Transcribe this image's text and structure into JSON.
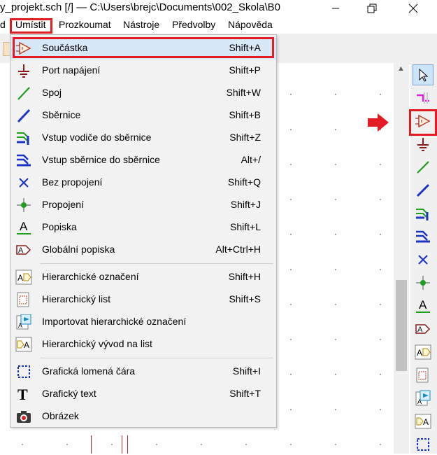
{
  "window": {
    "title": "y_projekt.sch [/] — C:\\Users\\brejc\\Documents\\002_Skola\\B0"
  },
  "menubar": {
    "items": [
      {
        "label": "d"
      },
      {
        "label": "Umístit"
      },
      {
        "label": "Prozkoumat"
      },
      {
        "label": "Nástroje"
      },
      {
        "label": "Předvolby"
      },
      {
        "label": "Nápověda"
      }
    ]
  },
  "dropdown": {
    "items": [
      {
        "label": "Součástka",
        "shortcut": "Shift+A",
        "icon": "component-icon"
      },
      {
        "label": "Port napájení",
        "shortcut": "Shift+P",
        "icon": "power-port-icon"
      },
      {
        "label": "Spoj",
        "shortcut": "Shift+W",
        "icon": "wire-icon"
      },
      {
        "label": "Sběrnice",
        "shortcut": "Shift+B",
        "icon": "bus-icon"
      },
      {
        "label": "Vstup vodiče do sběrnice",
        "shortcut": "Shift+Z",
        "icon": "wire-to-bus-icon"
      },
      {
        "label": "Vstup sběrnice do sběrnice",
        "shortcut": "Alt+/",
        "icon": "bus-to-bus-icon"
      },
      {
        "label": "Bez propojení",
        "shortcut": "Shift+Q",
        "icon": "no-connect-icon"
      },
      {
        "label": "Propojení",
        "shortcut": "Shift+J",
        "icon": "junction-icon"
      },
      {
        "label": "Popiska",
        "shortcut": "Shift+L",
        "icon": "label-icon"
      },
      {
        "label": "Globální popiska",
        "shortcut": "Alt+Ctrl+H",
        "icon": "global-label-icon"
      },
      {
        "label": "Hierarchické označení",
        "shortcut": "Shift+H",
        "icon": "hier-label-icon"
      },
      {
        "label": "Hierarchický list",
        "shortcut": "Shift+S",
        "icon": "hier-sheet-icon"
      },
      {
        "label": "Importovat hierarchické označení",
        "shortcut": "",
        "icon": "import-hier-label-icon"
      },
      {
        "label": "Hierarchický vývod na list",
        "shortcut": "",
        "icon": "hier-pin-icon"
      },
      {
        "label": "Grafická lomená čára",
        "shortcut": "Shift+I",
        "icon": "graphic-polyline-icon"
      },
      {
        "label": "Grafický text",
        "shortcut": "Shift+T",
        "icon": "graphic-text-icon"
      },
      {
        "label": "Obrázek",
        "shortcut": "",
        "icon": "image-icon"
      }
    ]
  },
  "right_toolbar": {
    "tools": [
      "select-icon",
      "highlight-net-icon",
      "component-icon",
      "power-port-icon",
      "wire-icon",
      "bus-icon",
      "wire-to-bus-icon",
      "bus-to-bus-icon",
      "no-connect-icon",
      "junction-icon",
      "label-icon",
      "global-label-icon",
      "hier-label-icon",
      "hier-sheet-icon",
      "import-hier-label-icon",
      "hier-pin-icon",
      "graphic-polyline-icon"
    ]
  },
  "colors": {
    "annotation_red": "#e31b23",
    "wire_green": "#1e9f1e",
    "bus_blue": "#1a34c8",
    "power_brown": "#8b1a1a"
  }
}
